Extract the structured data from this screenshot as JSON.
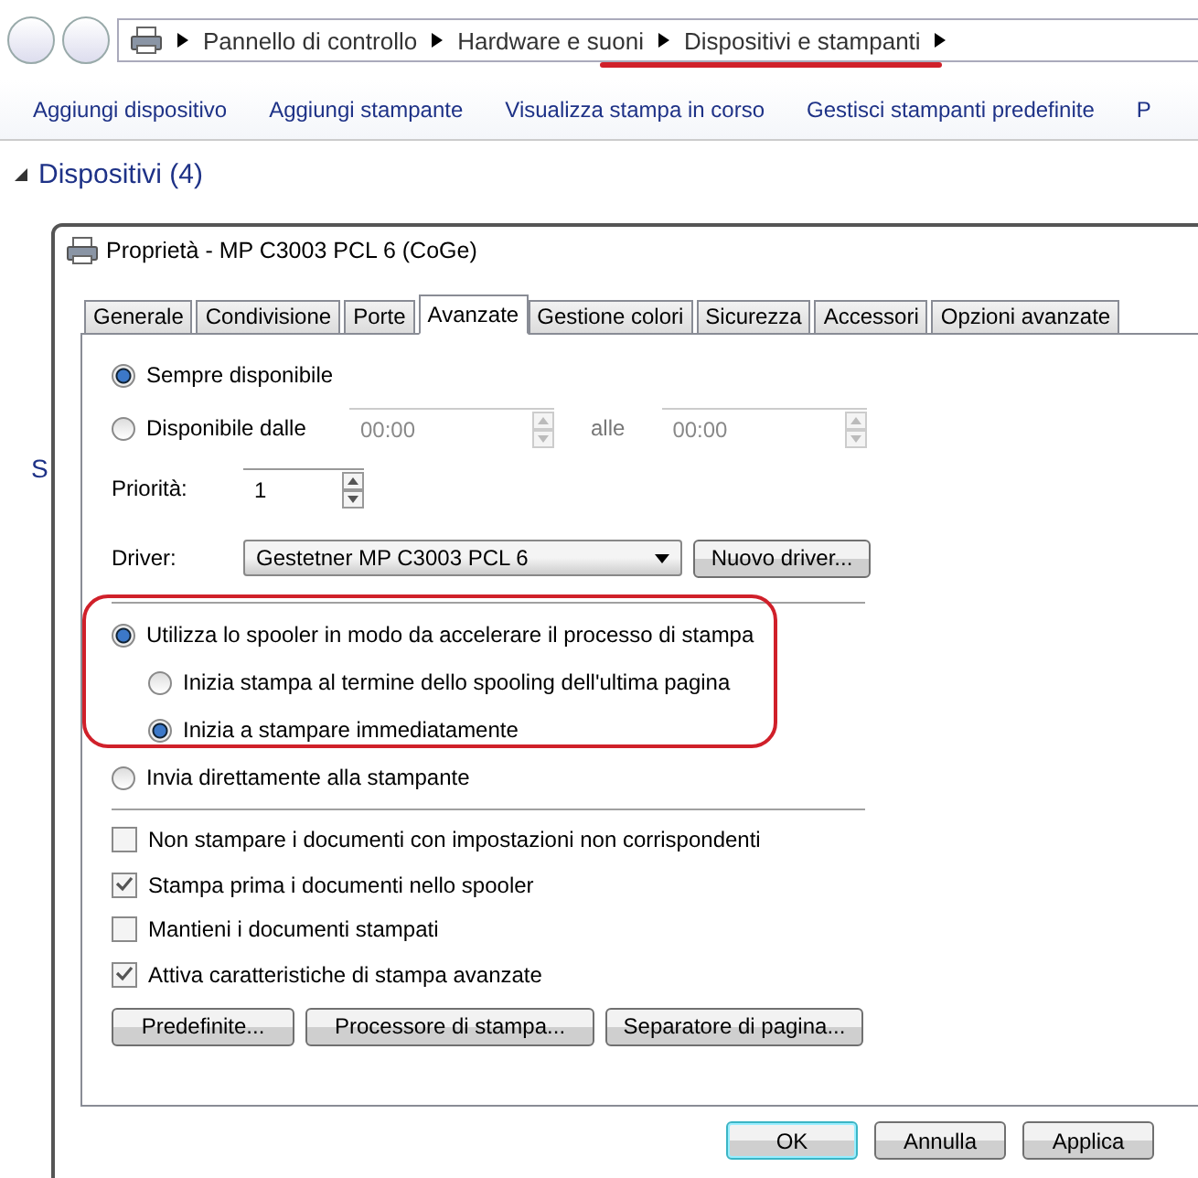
{
  "address_bar": {
    "crumbs": [
      "Pannello di controllo",
      "Hardware e suoni",
      "Dispositivi e stampanti"
    ]
  },
  "toolbar": [
    "Aggiungi dispositivo",
    "Aggiungi stampante",
    "Visualizza stampa in corso",
    "Gestisci stampanti predefinite",
    "P"
  ],
  "section": {
    "title": "Dispositivi (4)"
  },
  "side_fragment": "S",
  "dialog": {
    "title": "Proprietà - MP C3003 PCL 6 (CoGe)",
    "tabs": [
      {
        "label": "Generale",
        "selected": false
      },
      {
        "label": "Condivisione",
        "selected": false
      },
      {
        "label": "Porte",
        "selected": false
      },
      {
        "label": "Avanzate",
        "selected": true
      },
      {
        "label": "Gestione colori",
        "selected": false
      },
      {
        "label": "Sicurezza",
        "selected": false
      },
      {
        "label": "Accessori",
        "selected": false
      },
      {
        "label": "Opzioni avanzate",
        "selected": false
      }
    ],
    "availability": [
      {
        "label": "Sempre disponibile",
        "selected": true
      },
      {
        "label": "Disponibile dalle",
        "selected": false
      }
    ],
    "time_from": {
      "value": "00:00",
      "disabled": true
    },
    "time_separator": "alle",
    "time_to": {
      "value": "00:00",
      "disabled": true
    },
    "priority_label": "Priorità:",
    "priority": "1",
    "driver_label": "Driver:",
    "driver": "Gestetner MP C3003 PCL 6",
    "new_driver_button": "Nuovo driver...",
    "spool_options": [
      {
        "label": "Utilizza lo spooler in modo da accelerare il processo di stampa",
        "selected": true,
        "children": [
          {
            "label": "Inizia stampa al termine dello spooling dell'ultima pagina",
            "selected": false
          },
          {
            "label": "Inizia a stampare immediatamente",
            "selected": true
          }
        ]
      },
      {
        "label": "Invia direttamente alla stampante",
        "selected": false
      }
    ],
    "checks": [
      {
        "label": "Non stampare i documenti con impostazioni non corrispondenti",
        "checked": false
      },
      {
        "label": "Stampa prima i documenti nello spooler",
        "checked": true
      },
      {
        "label": "Mantieni i documenti stampati",
        "checked": false
      },
      {
        "label": "Attiva caratteristiche di stampa avanzate",
        "checked": true
      }
    ],
    "buttons": [
      "Predefinite...",
      "Processore di stampa...",
      "Separatore di pagina..."
    ],
    "footer_buttons": [
      {
        "label": "OK",
        "default": true
      },
      {
        "label": "Annulla",
        "default": false
      },
      {
        "label": "Applica",
        "default": false
      }
    ]
  }
}
